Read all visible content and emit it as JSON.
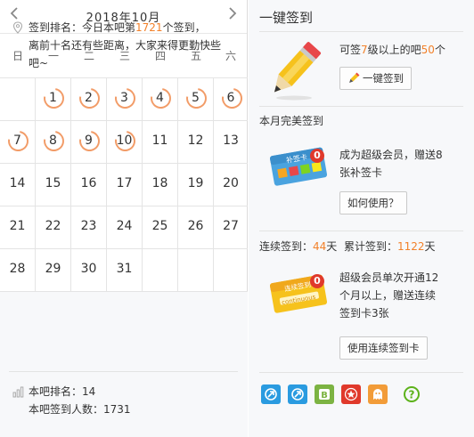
{
  "calendar": {
    "title": "2018年10月",
    "prev_icon": "chevron-left-icon",
    "next_icon": "chevron-right-icon",
    "weekdays": [
      "日",
      "一",
      "二",
      "三",
      "四",
      "五",
      "六"
    ],
    "rows": [
      [
        {
          "d": ""
        },
        {
          "d": "1",
          "s": true
        },
        {
          "d": "2",
          "s": true
        },
        {
          "d": "3",
          "s": true
        },
        {
          "d": "4",
          "s": true
        },
        {
          "d": "5",
          "s": true
        },
        {
          "d": "6",
          "s": true
        }
      ],
      [
        {
          "d": "7",
          "s": true
        },
        {
          "d": "8",
          "s": true
        },
        {
          "d": "9",
          "s": true
        },
        {
          "d": "10",
          "s": true
        },
        {
          "d": "11"
        },
        {
          "d": "12"
        },
        {
          "d": "13"
        }
      ],
      [
        {
          "d": "14"
        },
        {
          "d": "15"
        },
        {
          "d": "16"
        },
        {
          "d": "17"
        },
        {
          "d": "18"
        },
        {
          "d": "19"
        },
        {
          "d": "20"
        }
      ],
      [
        {
          "d": "21"
        },
        {
          "d": "22"
        },
        {
          "d": "23"
        },
        {
          "d": "24"
        },
        {
          "d": "25"
        },
        {
          "d": "26"
        },
        {
          "d": "27"
        }
      ],
      [
        {
          "d": "28"
        },
        {
          "d": "29"
        },
        {
          "d": "30"
        },
        {
          "d": "31"
        },
        {
          "d": ""
        },
        {
          "d": ""
        },
        {
          "d": ""
        }
      ]
    ]
  },
  "stats": {
    "rank_prefix": "签到排名：今日本吧第",
    "rank_value": "1721",
    "rank_suffix": "个签到，",
    "rank_line2": "离前十名还有些距离，大家来得更勤快些",
    "rank_line3": "吧~",
    "bar_rank_label": "本吧排名：14",
    "bar_count_label": "本吧签到人数：1731"
  },
  "one_key": {
    "title": "一键签到",
    "text_prefix": "可签",
    "level": "7",
    "text_mid": "级以上的吧",
    "count": "50",
    "text_suffix": "个",
    "button": "一键签到"
  },
  "perfect": {
    "title": "本月完美签到",
    "badge": "0",
    "card_label": "补签卡",
    "line1": "成为超级会员，赠送8",
    "line2": "张补签卡",
    "button": "如何使用？"
  },
  "streak": {
    "label_prefix": "连续签到：",
    "days": "44",
    "days_unit": "天",
    "total_prefix": "累计签到：",
    "total": "1122",
    "total_unit": "天",
    "badge": "0",
    "card_label": "连续签到卡",
    "card_sub": "continuous",
    "line1": "超级会员单次开通12",
    "line2": "个月以上，赠送连续",
    "line3": "签到卡3张",
    "button": "使用连续签到卡"
  },
  "colors": {
    "accent": "#f2812a",
    "ring": "#f29c68",
    "badge": "#e0392b"
  },
  "bottom_icons": [
    "share-icon-1",
    "share-icon-2",
    "b-icon",
    "star-icon",
    "ghost-icon",
    "help-icon"
  ]
}
